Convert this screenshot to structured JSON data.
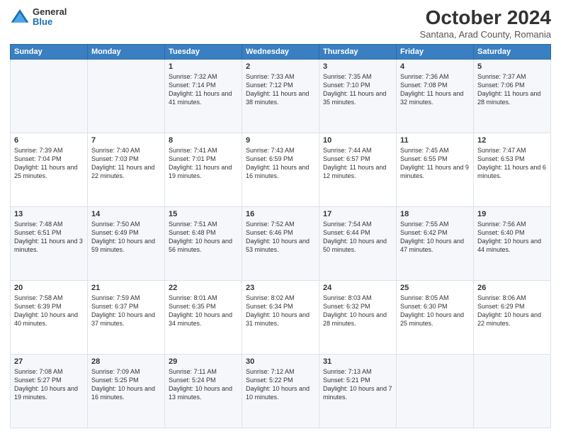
{
  "header": {
    "logo_general": "General",
    "logo_blue": "Blue",
    "month_title": "October 2024",
    "subtitle": "Santana, Arad County, Romania"
  },
  "days_of_week": [
    "Sunday",
    "Monday",
    "Tuesday",
    "Wednesday",
    "Thursday",
    "Friday",
    "Saturday"
  ],
  "weeks": [
    [
      {
        "day": "",
        "content": ""
      },
      {
        "day": "",
        "content": ""
      },
      {
        "day": "1",
        "content": "Sunrise: 7:32 AM\nSunset: 7:14 PM\nDaylight: 11 hours and 41 minutes."
      },
      {
        "day": "2",
        "content": "Sunrise: 7:33 AM\nSunset: 7:12 PM\nDaylight: 11 hours and 38 minutes."
      },
      {
        "day": "3",
        "content": "Sunrise: 7:35 AM\nSunset: 7:10 PM\nDaylight: 11 hours and 35 minutes."
      },
      {
        "day": "4",
        "content": "Sunrise: 7:36 AM\nSunset: 7:08 PM\nDaylight: 11 hours and 32 minutes."
      },
      {
        "day": "5",
        "content": "Sunrise: 7:37 AM\nSunset: 7:06 PM\nDaylight: 11 hours and 28 minutes."
      }
    ],
    [
      {
        "day": "6",
        "content": "Sunrise: 7:39 AM\nSunset: 7:04 PM\nDaylight: 11 hours and 25 minutes."
      },
      {
        "day": "7",
        "content": "Sunrise: 7:40 AM\nSunset: 7:03 PM\nDaylight: 11 hours and 22 minutes."
      },
      {
        "day": "8",
        "content": "Sunrise: 7:41 AM\nSunset: 7:01 PM\nDaylight: 11 hours and 19 minutes."
      },
      {
        "day": "9",
        "content": "Sunrise: 7:43 AM\nSunset: 6:59 PM\nDaylight: 11 hours and 16 minutes."
      },
      {
        "day": "10",
        "content": "Sunrise: 7:44 AM\nSunset: 6:57 PM\nDaylight: 11 hours and 12 minutes."
      },
      {
        "day": "11",
        "content": "Sunrise: 7:45 AM\nSunset: 6:55 PM\nDaylight: 11 hours and 9 minutes."
      },
      {
        "day": "12",
        "content": "Sunrise: 7:47 AM\nSunset: 6:53 PM\nDaylight: 11 hours and 6 minutes."
      }
    ],
    [
      {
        "day": "13",
        "content": "Sunrise: 7:48 AM\nSunset: 6:51 PM\nDaylight: 11 hours and 3 minutes."
      },
      {
        "day": "14",
        "content": "Sunrise: 7:50 AM\nSunset: 6:49 PM\nDaylight: 10 hours and 59 minutes."
      },
      {
        "day": "15",
        "content": "Sunrise: 7:51 AM\nSunset: 6:48 PM\nDaylight: 10 hours and 56 minutes."
      },
      {
        "day": "16",
        "content": "Sunrise: 7:52 AM\nSunset: 6:46 PM\nDaylight: 10 hours and 53 minutes."
      },
      {
        "day": "17",
        "content": "Sunrise: 7:54 AM\nSunset: 6:44 PM\nDaylight: 10 hours and 50 minutes."
      },
      {
        "day": "18",
        "content": "Sunrise: 7:55 AM\nSunset: 6:42 PM\nDaylight: 10 hours and 47 minutes."
      },
      {
        "day": "19",
        "content": "Sunrise: 7:56 AM\nSunset: 6:40 PM\nDaylight: 10 hours and 44 minutes."
      }
    ],
    [
      {
        "day": "20",
        "content": "Sunrise: 7:58 AM\nSunset: 6:39 PM\nDaylight: 10 hours and 40 minutes."
      },
      {
        "day": "21",
        "content": "Sunrise: 7:59 AM\nSunset: 6:37 PM\nDaylight: 10 hours and 37 minutes."
      },
      {
        "day": "22",
        "content": "Sunrise: 8:01 AM\nSunset: 6:35 PM\nDaylight: 10 hours and 34 minutes."
      },
      {
        "day": "23",
        "content": "Sunrise: 8:02 AM\nSunset: 6:34 PM\nDaylight: 10 hours and 31 minutes."
      },
      {
        "day": "24",
        "content": "Sunrise: 8:03 AM\nSunset: 6:32 PM\nDaylight: 10 hours and 28 minutes."
      },
      {
        "day": "25",
        "content": "Sunrise: 8:05 AM\nSunset: 6:30 PM\nDaylight: 10 hours and 25 minutes."
      },
      {
        "day": "26",
        "content": "Sunrise: 8:06 AM\nSunset: 6:29 PM\nDaylight: 10 hours and 22 minutes."
      }
    ],
    [
      {
        "day": "27",
        "content": "Sunrise: 7:08 AM\nSunset: 5:27 PM\nDaylight: 10 hours and 19 minutes."
      },
      {
        "day": "28",
        "content": "Sunrise: 7:09 AM\nSunset: 5:25 PM\nDaylight: 10 hours and 16 minutes."
      },
      {
        "day": "29",
        "content": "Sunrise: 7:11 AM\nSunset: 5:24 PM\nDaylight: 10 hours and 13 minutes."
      },
      {
        "day": "30",
        "content": "Sunrise: 7:12 AM\nSunset: 5:22 PM\nDaylight: 10 hours and 10 minutes."
      },
      {
        "day": "31",
        "content": "Sunrise: 7:13 AM\nSunset: 5:21 PM\nDaylight: 10 hours and 7 minutes."
      },
      {
        "day": "",
        "content": ""
      },
      {
        "day": "",
        "content": ""
      }
    ]
  ]
}
